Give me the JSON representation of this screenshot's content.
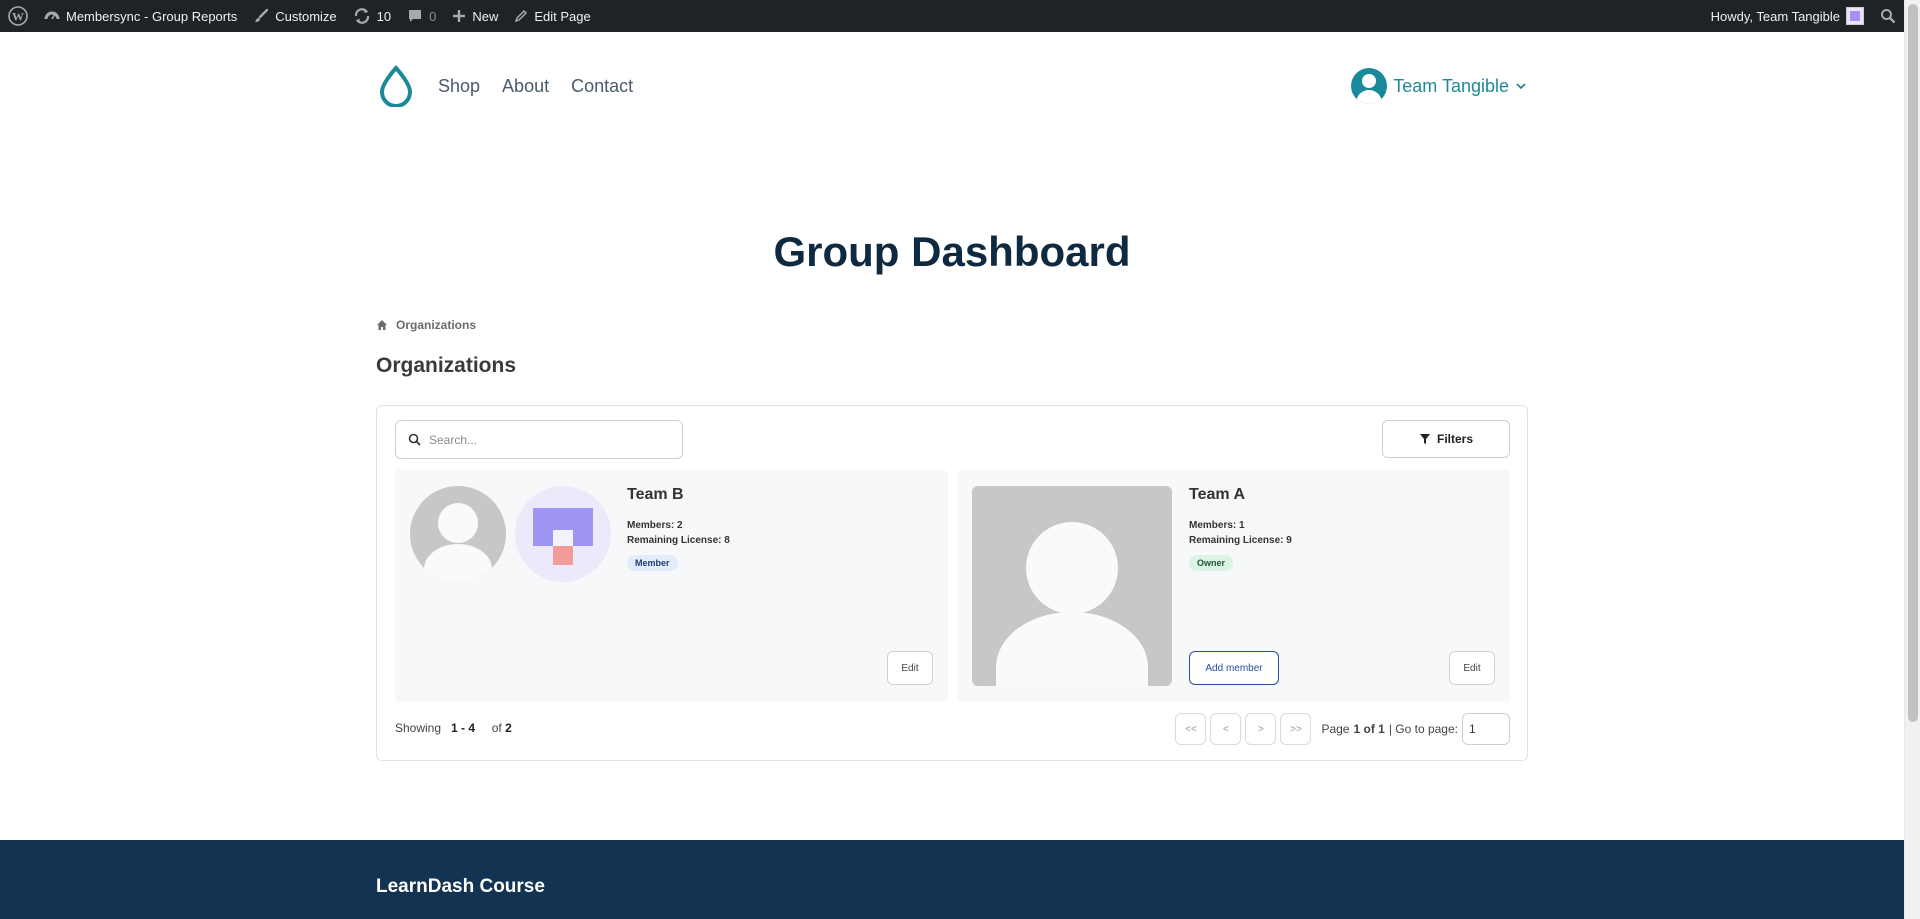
{
  "adminbar": {
    "site_name": "Membersync - Group Reports",
    "customize": "Customize",
    "updates_count": "10",
    "comments_count": "0",
    "new_label": "New",
    "edit_page": "Edit Page",
    "howdy": "Howdy, Team Tangible"
  },
  "nav": {
    "items": [
      "Shop",
      "About",
      "Contact"
    ]
  },
  "user": {
    "name": "Team Tangible"
  },
  "page": {
    "title": "Group Dashboard",
    "breadcrumb": "Organizations",
    "section_title": "Organizations"
  },
  "toolbar": {
    "search_placeholder": "Search...",
    "filters_label": "Filters"
  },
  "cards": [
    {
      "name": "Team B",
      "members": "Members: 2",
      "remaining": "Remaining License: 8",
      "role": "Member",
      "edit_label": "Edit"
    },
    {
      "name": "Team A",
      "members": "Members: 1",
      "remaining": "Remaining License: 9",
      "role": "Owner",
      "add_member_label": "Add member",
      "edit_label": "Edit"
    }
  ],
  "pagination": {
    "showing_label": "Showing",
    "range": "1 - 4",
    "of_label": "of",
    "total": "2",
    "first": "<<",
    "prev": "<",
    "next": ">",
    "last": ">>",
    "page_label": "Page",
    "page_of": "1 of 1",
    "goto_label": "| Go to page:",
    "goto_value": "1"
  },
  "footer": {
    "title": "LearnDash Course"
  },
  "colors": {
    "adminbar_bg": "#1d2327",
    "accent": "#1a8a9a",
    "title": "#0f2a40",
    "footer_bg": "#133352"
  }
}
